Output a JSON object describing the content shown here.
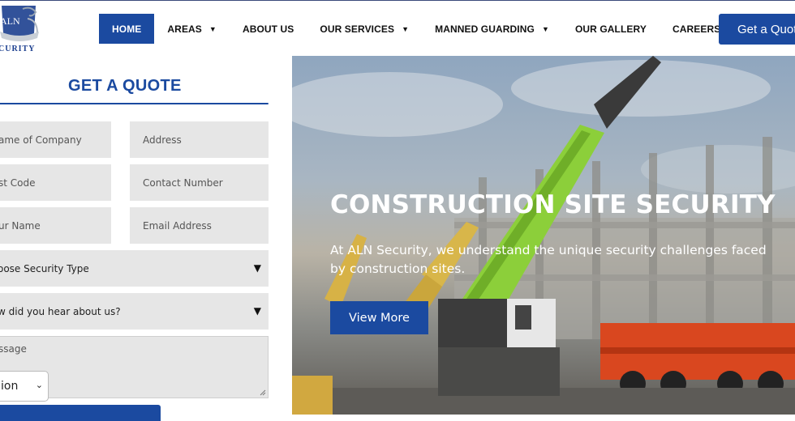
{
  "header": {
    "logo": {
      "top_text": "ALN",
      "bottom_text": "CURITY"
    },
    "nav": [
      {
        "label": "HOME",
        "active": true,
        "dropdown": false
      },
      {
        "label": "AREAS",
        "active": false,
        "dropdown": true
      },
      {
        "label": "ABOUT US",
        "active": false,
        "dropdown": false
      },
      {
        "label": "OUR SERVICES",
        "active": false,
        "dropdown": true
      },
      {
        "label": "MANNED GUARDING",
        "active": false,
        "dropdown": true
      },
      {
        "label": "OUR GALLERY",
        "active": false,
        "dropdown": false
      },
      {
        "label": "CAREERS",
        "active": false,
        "dropdown": false
      }
    ],
    "quote_button": "Get a Quote"
  },
  "form": {
    "title": "GET A QUOTE",
    "company_placeholder": "ame of Company",
    "address_placeholder": "Address",
    "postcode_placeholder": "st Code",
    "contact_placeholder": "Contact Number",
    "name_placeholder": "ur Name",
    "email_placeholder": "Email Address",
    "security_type": "oose Security Type",
    "hear_about": "w did you hear about us?",
    "message_placeholder": "ssage",
    "small_select_value": "ion"
  },
  "hero": {
    "title": "CONSTRUCTION SITE SECURITY",
    "text": "At ALN Security, we understand the unique security challenges faced by construction sites.",
    "button": "View More"
  },
  "colors": {
    "brand_blue": "#1b4aa0",
    "field_grey": "#e6e6e6"
  }
}
